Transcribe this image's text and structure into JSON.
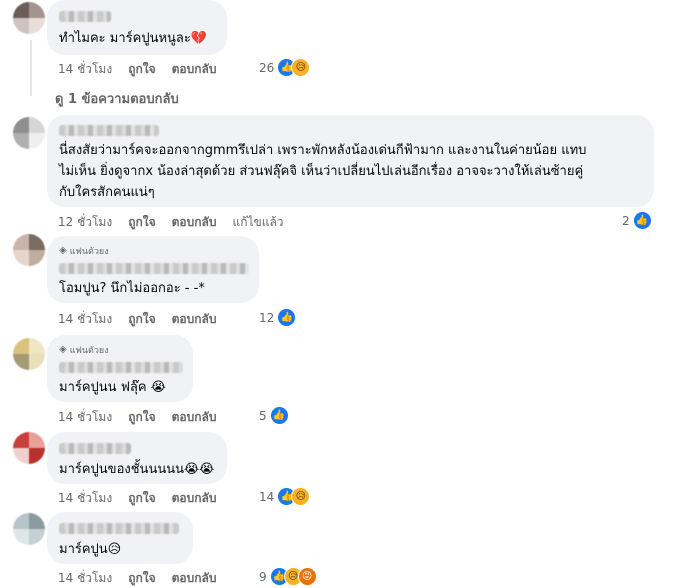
{
  "comments": [
    {
      "text": "ทำไมคะ มาร์คปูนหนูละ💔",
      "time": "14 ชั่วโมง",
      "like": "ถูกใจ",
      "reply": "ตอบกลับ",
      "reaction_count": "26",
      "reaction_icons": [
        "like-icon",
        "sad-icon"
      ]
    },
    {
      "text_lines": [
        "นี่สงสัยว่ามาร์คจะออกจากgmmรึเปล่า เพราะพักหลังน้องเด่นกีฟ้ามาก และงานในค่ายน้อย แทบ",
        "ไม่เห็น ยิ่งดูจากx น้องล่าสุดด้วย ส่วนฟลุ๊คจิ เห็นว่าเปลี่ยนไปเล่นอีกเรื่อง อาจจะวางให้เล่นซ้ายคู่",
        "กับใครสักคนแน่ๆ"
      ],
      "time": "12 ชั่วโมง",
      "like": "ถูกใจ",
      "reply": "ตอบกลับ",
      "edited": "แก้ไขแล้ว",
      "reaction_count": "2",
      "reaction_icons": [
        "like-icon"
      ]
    },
    {
      "badge": "แฟนตัวยง",
      "text": "โอมปูน? นึกไม่ออกอะ - -*",
      "time": "14 ชั่วโมง",
      "like": "ถูกใจ",
      "reply": "ตอบกลับ",
      "reaction_count": "12",
      "reaction_icons": [
        "like-icon"
      ]
    },
    {
      "badge": "แฟนตัวยง",
      "text": "มาร์คปูนน ฟลุ๊ค 😭",
      "time": "14 ชั่วโมง",
      "like": "ถูกใจ",
      "reply": "ตอบกลับ",
      "reaction_count": "5",
      "reaction_icons": [
        "like-icon"
      ]
    },
    {
      "text": "มาร์คปูนของชั้นนนนน😭😭",
      "time": "14 ชั่วโมง",
      "like": "ถูกใจ",
      "reply": "ตอบกลับ",
      "reaction_count": "14",
      "reaction_icons": [
        "like-icon",
        "sad-icon"
      ]
    },
    {
      "text": "มาร์คปูน😥",
      "time": "14 ชั่วโมง",
      "like": "ถูกใจ",
      "reply": "ตอบกลับ",
      "reaction_count": "9",
      "reaction_icons": [
        "like-icon",
        "sad-icon",
        "angry-icon"
      ]
    }
  ],
  "view_replies": "ดู 1 ข้อความตอบกลับ",
  "colors": {
    "bubble": "#f0f2f5",
    "meta": "#65676b",
    "like": "#1877f2",
    "sad": "#f7b125",
    "angry": "#e9710f"
  }
}
